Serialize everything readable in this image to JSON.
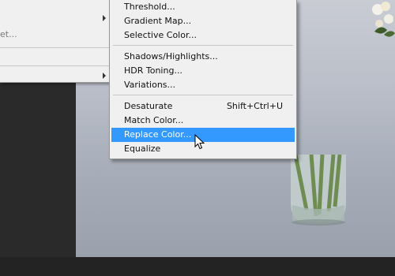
{
  "parent_menu": {
    "items": [
      {
        "label": "",
        "has_submenu": false
      },
      {
        "label": "",
        "has_submenu": true
      },
      {
        "label": "et...",
        "has_submenu": false
      },
      {
        "label": "",
        "has_submenu": false
      },
      {
        "label": "",
        "has_submenu": true
      }
    ]
  },
  "submenu": {
    "groups": [
      [
        {
          "label": "Threshold..."
        },
        {
          "label": "Gradient Map..."
        },
        {
          "label": "Selective Color..."
        }
      ],
      [
        {
          "label": "Shadows/Highlights..."
        },
        {
          "label": "HDR Toning..."
        },
        {
          "label": "Variations..."
        }
      ],
      [
        {
          "label": "Desaturate",
          "shortcut": "Shift+Ctrl+U"
        },
        {
          "label": "Match Color..."
        },
        {
          "label": "Replace Color...",
          "highlighted": true
        },
        {
          "label": "Equalize"
        }
      ]
    ]
  },
  "colors": {
    "highlight": "#3399ff",
    "menu_bg": "#f0f0f0",
    "workspace": "#2b2b2b"
  }
}
